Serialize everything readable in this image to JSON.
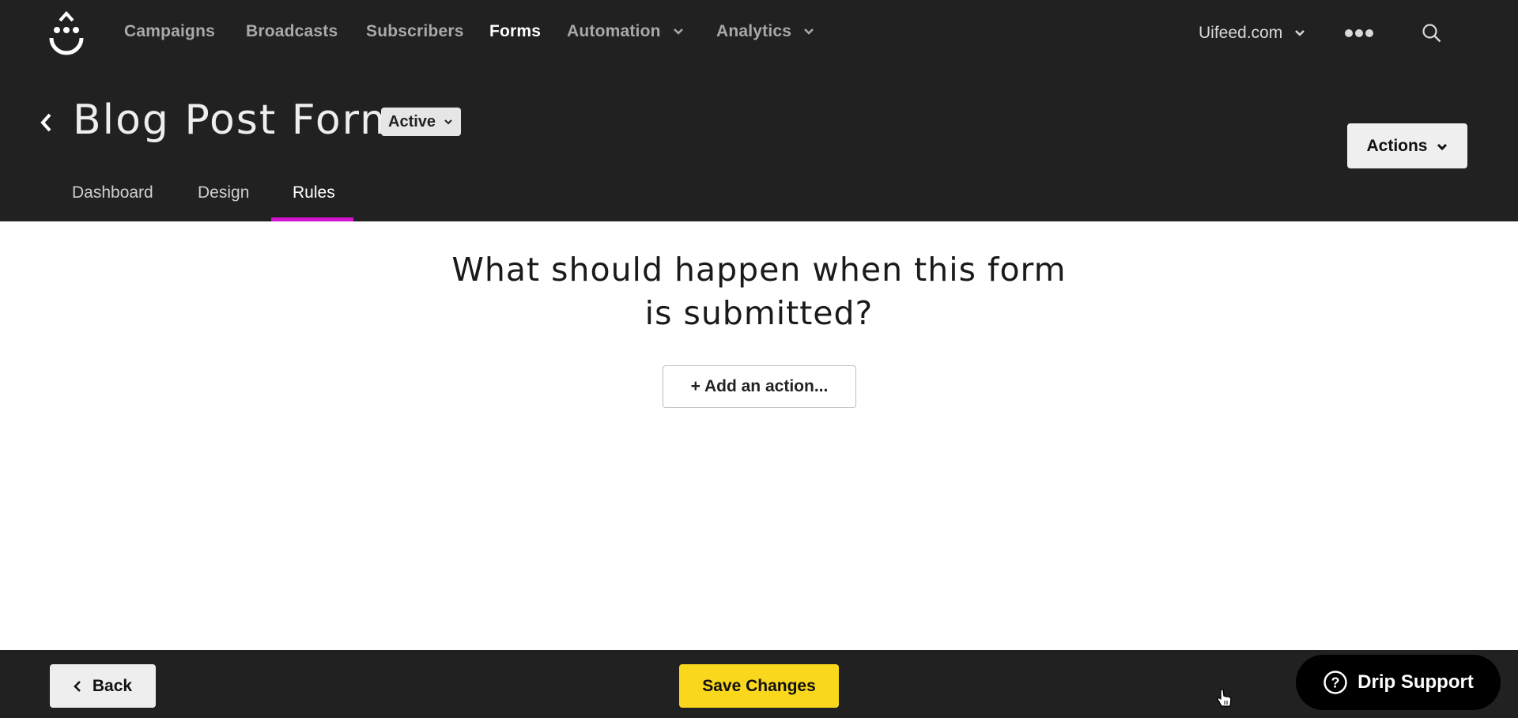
{
  "nav": {
    "logo_icon": "drip-smiley-logo",
    "items": [
      {
        "label": "Campaigns",
        "active": false
      },
      {
        "label": "Broadcasts",
        "active": false
      },
      {
        "label": "Subscribers",
        "active": false
      },
      {
        "label": "Forms",
        "active": true
      },
      {
        "label": "Automation",
        "active": false,
        "dropdown": true
      },
      {
        "label": "Analytics",
        "active": false,
        "dropdown": true
      }
    ],
    "account": "Uifeed.com",
    "more_icon": "more-dots-icon",
    "search_icon": "search-icon"
  },
  "page": {
    "title": "Blog Post Form",
    "status": "Active",
    "actions_label": "Actions",
    "tabs": [
      {
        "label": "Dashboard",
        "active": false
      },
      {
        "label": "Design",
        "active": false
      },
      {
        "label": "Rules",
        "active": true
      }
    ],
    "accent_color": "#d414d0"
  },
  "main": {
    "question": "What should happen when this form is submitted?",
    "add_action_label": "+ Add an action..."
  },
  "footer": {
    "back_label": "Back",
    "save_label": "Save Changes",
    "save_color": "#f9d71c",
    "support_label": "Drip Support"
  }
}
